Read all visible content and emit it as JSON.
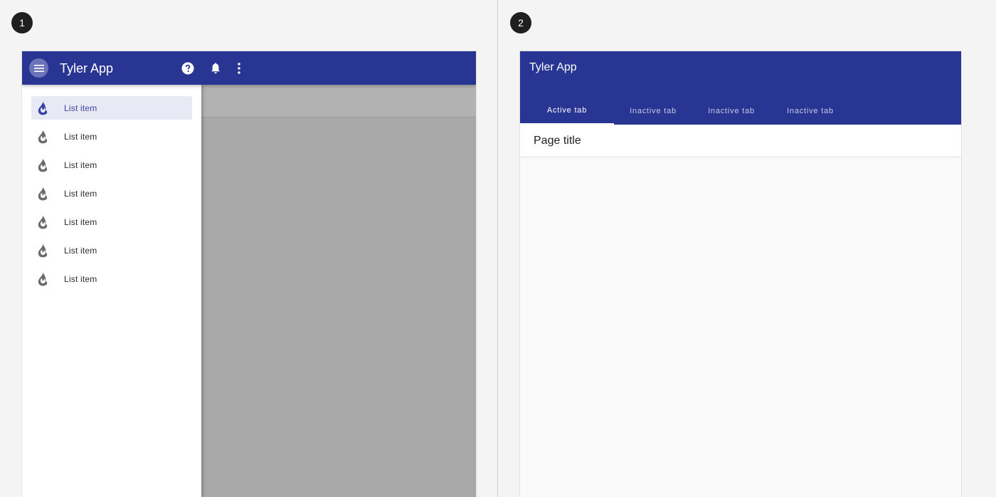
{
  "badges": {
    "one": "1",
    "two": "2"
  },
  "colors": {
    "primary": "#293593",
    "selected_bg": "#e8e9f4",
    "selected_text": "#3a45a3",
    "scrim": "#a8a8a8"
  },
  "panel1": {
    "app_title": "Tyler App",
    "header_icons": [
      "menu-icon",
      "help-icon",
      "bell-icon",
      "more-vert-icon"
    ],
    "drawer": {
      "items": [
        {
          "label": "List item",
          "icon": "flame-icon",
          "selected": true
        },
        {
          "label": "List item",
          "icon": "flame-icon",
          "selected": false
        },
        {
          "label": "List item",
          "icon": "flame-icon",
          "selected": false
        },
        {
          "label": "List item",
          "icon": "flame-icon",
          "selected": false
        },
        {
          "label": "List item",
          "icon": "flame-icon",
          "selected": false
        },
        {
          "label": "List item",
          "icon": "flame-icon",
          "selected": false
        },
        {
          "label": "List item",
          "icon": "flame-icon",
          "selected": false
        }
      ]
    }
  },
  "panel2": {
    "app_title": "Tyler App",
    "tabs": [
      {
        "label": "Active tab",
        "active": true
      },
      {
        "label": "Inactive tab",
        "active": false
      },
      {
        "label": "Inactive tab",
        "active": false
      },
      {
        "label": "Inactive tab",
        "active": false
      }
    ],
    "page_title": "Page title"
  }
}
